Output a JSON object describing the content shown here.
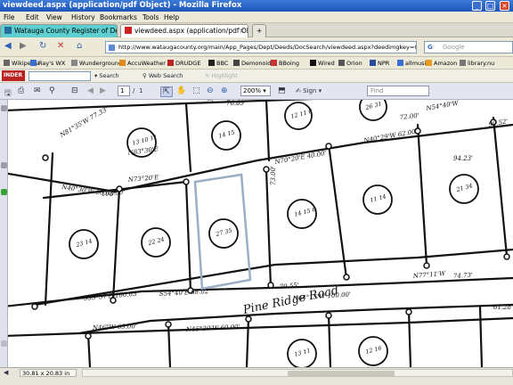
{
  "window": {
    "title": "viewdeed.aspx (application/pdf Object) - Mozilla Firefox",
    "controls": [
      "_",
      "□",
      "×"
    ]
  },
  "menu": [
    "File",
    "Edit",
    "View",
    "History",
    "Bookmarks",
    "Tools",
    "Help"
  ],
  "tabs": [
    {
      "label": "Watauga County Register of Deeds",
      "active": false,
      "closable": false
    },
    {
      "label": "viewdeed.aspx (application/pdf Ob...",
      "active": true,
      "closable": true
    }
  ],
  "new_tab_label": "+",
  "nav": {
    "back": "◀",
    "forward": "▶",
    "reload": "↻",
    "stop": "✕",
    "home": "⌂",
    "url": "http://www.wataugacounty.org/main/App_Pages/Dept/Deeds/DocSearch/viewdeed.aspx?deedimgkey=C",
    "search_placeholder": "Google",
    "search_engine_glyph": "G"
  },
  "bookmarks": [
    {
      "label": "Wikipedia",
      "color": "#666"
    },
    {
      "label": "Ray's WX",
      "color": "#3a6ed0"
    },
    {
      "label": "Wunderground",
      "color": "#888"
    },
    {
      "label": "AccuWeather",
      "color": "#e08b1c"
    },
    {
      "label": "DRUDGE",
      "color": "#b22"
    },
    {
      "label": "BBC",
      "color": "#222"
    },
    {
      "label": "Demonoid",
      "color": "#444"
    },
    {
      "label": "BBoing",
      "color": "#c33"
    },
    {
      "label": "Wired",
      "color": "#111"
    },
    {
      "label": "Orion",
      "color": "#555"
    },
    {
      "label": "NPR",
      "color": "#2b4d9b"
    },
    {
      "label": "allmusic",
      "color": "#3a6ed0"
    },
    {
      "label": "Amazon",
      "color": "#e89b1c"
    },
    {
      "label": "library.nu",
      "color": "#777"
    }
  ],
  "toolbar2": {
    "logo": "INDER",
    "items": [
      {
        "label": "Search",
        "disabled": false
      },
      {
        "label": "Web Search",
        "disabled": false
      },
      {
        "label": "Highlight",
        "disabled": true
      }
    ]
  },
  "pdf": {
    "page_current": "1",
    "page_separator": "/",
    "page_total": "1",
    "zoom": "200%",
    "sign_label": "Sign",
    "find_placeholder": "Find"
  },
  "status": {
    "dimensions": "30.81 x 20.83 in"
  },
  "map_labels": {
    "road": "Pine Ridge Road",
    "bearings": [
      "N81°35'W 77.33'",
      "N40°30'W 50.00'",
      "N73°20'E",
      "N70°20'E 40.00'",
      "N37°36'W 50.00'",
      "N40°29'W 62.00'",
      "N83°30'E",
      "N54°40'W",
      "S55°57'E 100.03'",
      "S54°40'E 68.02'",
      "N64°15'W 100.00'",
      "N45°30'W 60.00'",
      "N46°W 65.00'",
      "N77°11'W",
      "74.73'",
      "76.69'",
      "72.00'",
      "103.00'",
      "70.55'",
      "73.00'",
      "94.23'",
      "99.52'",
      "61.28'"
    ],
    "lot_marks": [
      "13 10 11",
      "14 15",
      "12 11 6",
      "26 31",
      "23 14",
      "22 24",
      "27 35",
      "14 15 6",
      "11 14",
      "21 34",
      "13 11",
      "12 16"
    ]
  }
}
